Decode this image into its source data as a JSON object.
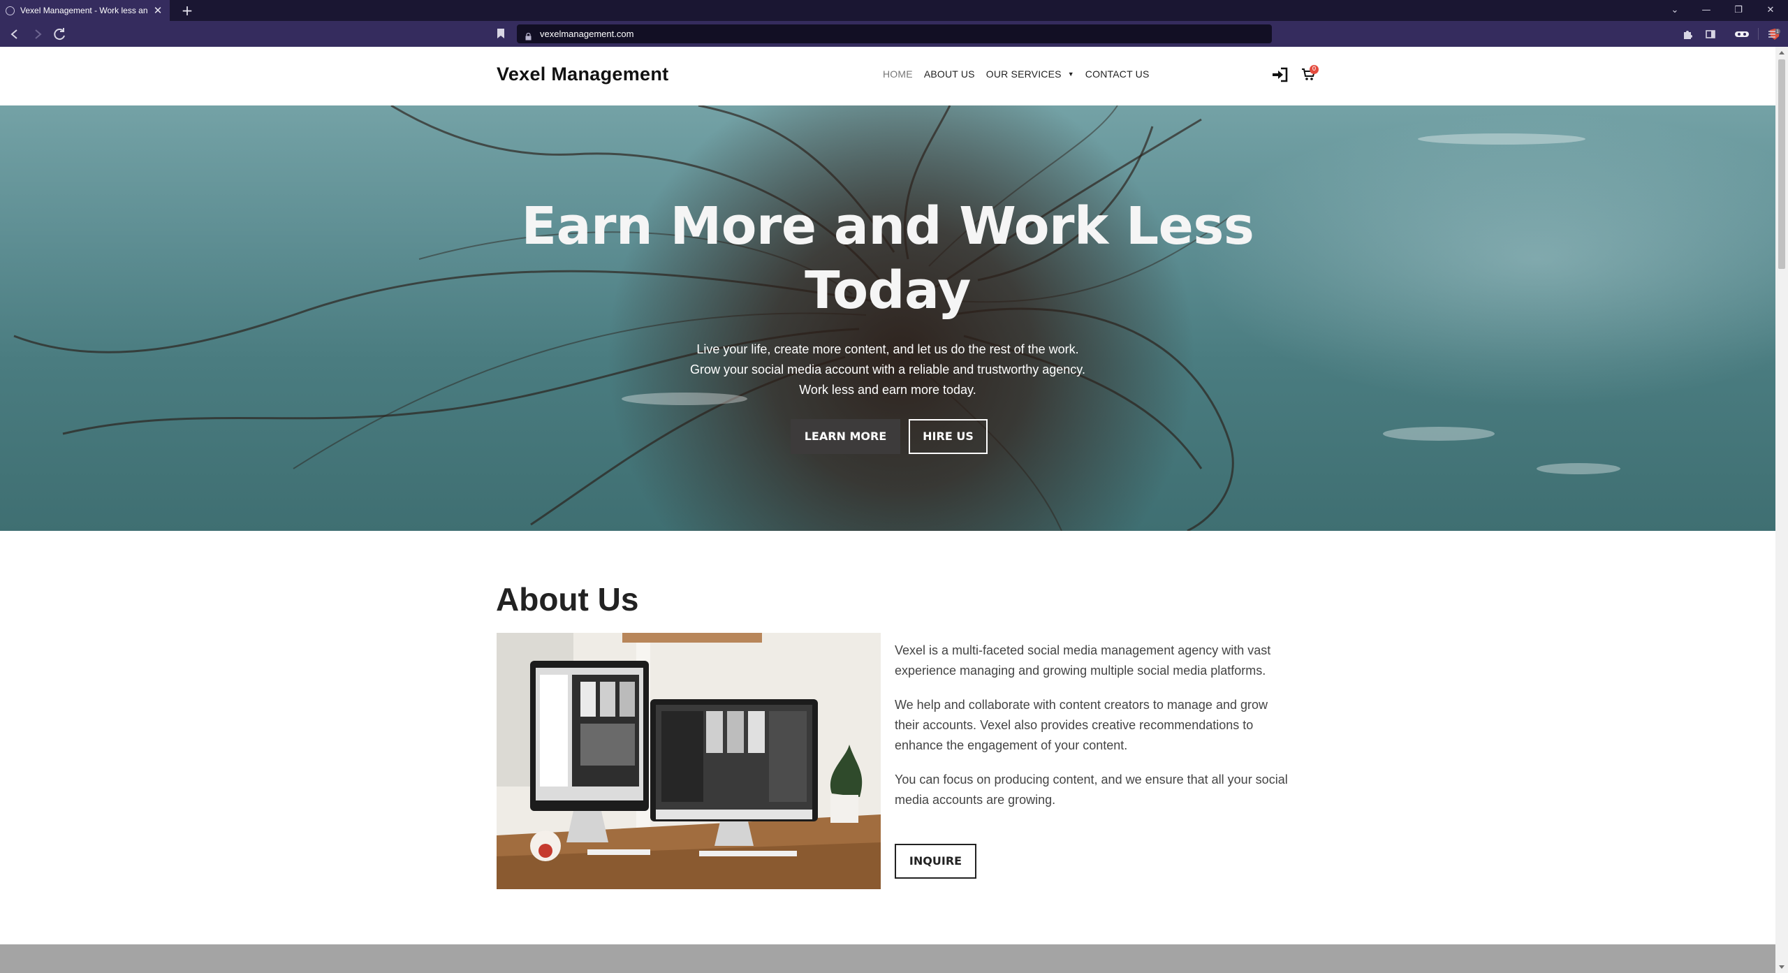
{
  "browser": {
    "tab_title": "Vexel Management - Work less an",
    "url": "vexelmanagement.com",
    "brave_count": "1"
  },
  "site": {
    "logo": "Vexel Management",
    "nav": [
      {
        "label": "HOME"
      },
      {
        "label": "ABOUT US"
      },
      {
        "label": "OUR SERVICES"
      },
      {
        "label": "CONTACT US"
      }
    ],
    "cart_count": "0"
  },
  "hero": {
    "title_line1": "Earn More and Work Less",
    "title_line2": "Today",
    "subtitle_line1": "Live your life, create more content, and let us do the rest of the work.",
    "subtitle_line2": "Grow your social media account with a reliable and trustworthy agency.",
    "subtitle_line3": "Work less and earn more today.",
    "learn_more": "LEARN MORE",
    "hire_us": "HIRE US"
  },
  "about": {
    "title": "About Us",
    "paragraphs": [
      "Vexel is a multi-faceted social media management agency with vast experience managing and growing multiple social media platforms.",
      "We help and collaborate with content creators to manage and grow their accounts. Vexel also provides creative recommendations to enhance the engagement of your content.",
      "You can focus on producing content, and we ensure that all your social media accounts are growing."
    ],
    "inquire": "INQUIRE"
  },
  "colors": {
    "chrome_bg": "#1a1632",
    "toolbar_bg": "#352c5e",
    "hero_water": "#4a7c80",
    "button_dark": "#3d3b3b",
    "badge": "#e44b3e"
  }
}
